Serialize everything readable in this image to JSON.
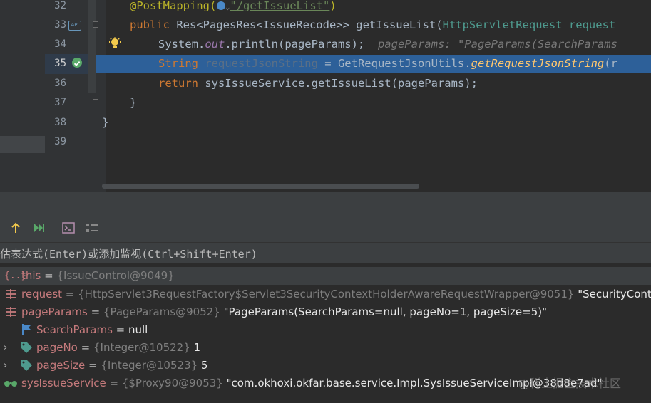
{
  "editor": {
    "line_numbers": [
      "32",
      "33",
      "34",
      "35",
      "36",
      "37",
      "38",
      "39"
    ],
    "lines": {
      "l32_annotation": "@PostMapping(",
      "l32_path": "\"/getIssueList\"",
      "l32_close": ")",
      "l33_public": "public",
      "l33_rest": " Res<PagesRes<IssueRecode>> getIssueList(",
      "l33_param": "HttpServletRequest request",
      "l34_system": "System.",
      "l34_out": "out",
      "l34_rest": ".println(pageParams);",
      "l34_hint": "pageParams: \"PageParams(SearchParams",
      "l35_string": "String ",
      "l35_var": "requestJsonString",
      "l35_eq": " = GetRequestJsonUtils.",
      "l35_method": "getRequestJsonString",
      "l35_tail": "(r",
      "l36_return": "return",
      "l36_rest": " sysIssueService.getIssueList(pageParams);",
      "l37": "}",
      "l38": "}"
    },
    "api_badge": "API"
  },
  "debug": {
    "eval_placeholder": "估表达式(Enter)或添加监视(Ctrl+Shift+Enter)",
    "variables": [
      {
        "name": "this",
        "type": "{IssueControl@9049}",
        "value": ""
      },
      {
        "name": "request",
        "type": "{HttpServlet3RequestFactory$Servlet3SecurityContextHolderAwareRequestWrapper@9051}",
        "value": "\"SecurityContextH"
      },
      {
        "name": "pageParams",
        "type": "{PageParams@9052}",
        "value": "\"PageParams(SearchParams=null, pageNo=1, pageSize=5)\""
      },
      {
        "name": "SearchParams",
        "type": "",
        "value": "null"
      },
      {
        "name": "pageNo",
        "type": "{Integer@10522}",
        "value": "1"
      },
      {
        "name": "pageSize",
        "type": "{Integer@10523}",
        "value": "5"
      },
      {
        "name": "sysIssueService",
        "type": "{$Proxy90@9053}",
        "value": "\"com.okhoxi.okfar.base.service.Impl.SysIssueServiceImpl@38d8e7ad\""
      }
    ],
    "eq": " = "
  },
  "watermark": "@稀土掘金技术社区",
  "colors": {
    "selection": "#2d6099",
    "keyword": "#cc7832",
    "string": "#6a8759",
    "var_name": "#c57a7c"
  }
}
